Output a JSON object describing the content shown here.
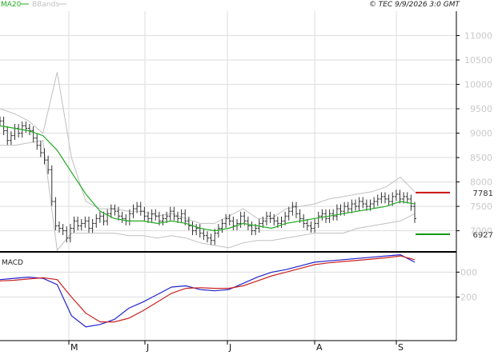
{
  "header": {
    "legend": [
      {
        "label": "MA20",
        "color": "#22aa22"
      },
      {
        "label": "BBands",
        "color": "#c0c0c0"
      }
    ],
    "source_stamp": "© TEC 9/9/2026 3:0 GMT"
  },
  "colors": {
    "price_bars": "#333333",
    "ma20": "#22aa22",
    "bbands": "#c0c0c0",
    "resistance": "#cc1111",
    "support": "#119911",
    "macd_line": "#2222cc",
    "signal_line": "#cc2222",
    "grid": "#dddddd",
    "axis_text": "#c8c8c8"
  },
  "chart_data": [
    {
      "type": "ohlc",
      "panel": "price",
      "y_ticks": [
        "11000",
        "10500",
        "10000",
        "9500",
        "9000",
        "8500",
        "8000",
        "7500",
        "7000"
      ],
      "ylim": [
        6600,
        11500
      ],
      "x_ticks": [
        "M",
        "J",
        "J",
        "A",
        "S"
      ],
      "levels": [
        {
          "name": "resistance",
          "value": 7781,
          "label": "7781"
        },
        {
          "name": "support",
          "value": 6927,
          "label": "6927"
        }
      ],
      "series": [
        {
          "name": "price",
          "closes": [
            9250,
            9050,
            8850,
            8950,
            9100,
            9000,
            9150,
            9100,
            9050,
            8900,
            8750,
            8600,
            8450,
            8250,
            7600,
            7100,
            7050,
            7000,
            6850,
            7050,
            7200,
            7100,
            7150,
            7200,
            7050,
            7150,
            7250,
            7300,
            7200,
            7350,
            7450,
            7400,
            7300,
            7250,
            7200,
            7350,
            7450,
            7500,
            7400,
            7300,
            7250,
            7350,
            7300,
            7200,
            7250,
            7300,
            7400,
            7300,
            7250,
            7350,
            7200,
            7100,
            7000,
            7050,
            6950,
            6900,
            6850,
            6800,
            6950,
            7050,
            7150,
            7250,
            7200,
            7100,
            7150,
            7300,
            7200,
            7100,
            7000,
            7050,
            7150,
            7200,
            7300,
            7250,
            7200,
            7150,
            7200,
            7300,
            7400,
            7500,
            7350,
            7250,
            7150,
            7100,
            7050,
            7150,
            7300,
            7350,
            7250,
            7350,
            7300,
            7450,
            7400,
            7500,
            7450,
            7550,
            7500,
            7600,
            7550,
            7500,
            7550,
            7600,
            7650,
            7700,
            7650,
            7600,
            7700,
            7750,
            7650,
            7700,
            7650,
            7500,
            7250
          ]
        },
        {
          "name": "MA20",
          "values": [
            9150,
            9100,
            9050,
            8950,
            8650,
            8200,
            7750,
            7400,
            7250,
            7200,
            7200,
            7150,
            7200,
            7150,
            7050,
            7000,
            7050,
            7150,
            7100,
            7050,
            7150,
            7200,
            7250,
            7300,
            7350,
            7400,
            7450,
            7500,
            7600,
            7550
          ]
        },
        {
          "name": "BBands upper",
          "values": [
            9500,
            9400,
            9250,
            9000,
            10250,
            8500,
            7600,
            7450,
            7450,
            7400,
            7400,
            7300,
            7350,
            7250,
            7150,
            7150,
            7300,
            7450,
            7250,
            7250,
            7450,
            7500,
            7550,
            7650,
            7700,
            7750,
            7800,
            7900,
            8100,
            7800
          ]
        },
        {
          "name": "BBands lower",
          "values": [
            8750,
            8750,
            8800,
            8850,
            6600,
            6950,
            6950,
            6950,
            6950,
            6900,
            6900,
            6850,
            6900,
            6850,
            6750,
            6700,
            6650,
            6750,
            6800,
            6800,
            6850,
            6900,
            6950,
            6950,
            6950,
            7050,
            7100,
            7150,
            7200,
            7350
          ]
        }
      ]
    },
    {
      "type": "line",
      "panel": "macd",
      "title": "MACD",
      "y_ticks": [
        "000",
        "-200"
      ],
      "ylim": [
        -550,
        150
      ],
      "x_ticks": [
        "M",
        "J",
        "J",
        "A",
        "S"
      ],
      "series": [
        {
          "name": "MACD",
          "values": [
            -60,
            -50,
            -40,
            -50,
            -100,
            -350,
            -440,
            -420,
            -380,
            -290,
            -240,
            -180,
            -120,
            -110,
            -140,
            -150,
            -140,
            -90,
            -40,
            0,
            20,
            50,
            80,
            90,
            100,
            110,
            120,
            130,
            140,
            80
          ]
        },
        {
          "name": "Signal",
          "values": [
            -70,
            -65,
            -55,
            -45,
            -60,
            -200,
            -330,
            -400,
            -400,
            -370,
            -310,
            -240,
            -170,
            -130,
            -125,
            -130,
            -130,
            -110,
            -70,
            -30,
            0,
            30,
            60,
            75,
            85,
            95,
            105,
            115,
            130,
            100
          ]
        }
      ]
    }
  ]
}
